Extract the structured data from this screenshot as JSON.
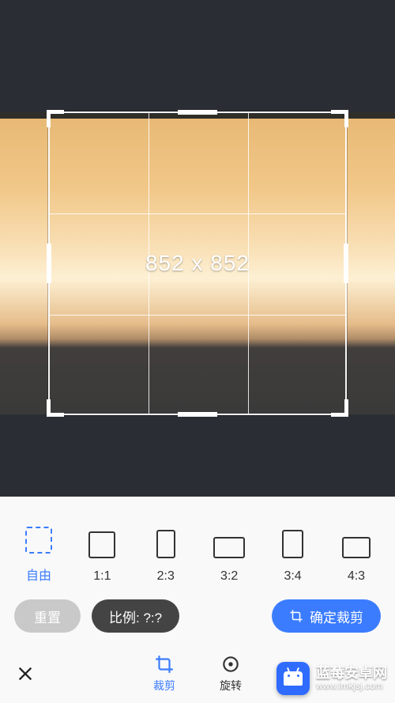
{
  "crop": {
    "dimensions_label": "852 x 852"
  },
  "ratios": [
    {
      "key": "free",
      "label": "自由",
      "active": true
    },
    {
      "key": "11",
      "label": "1:1",
      "active": false
    },
    {
      "key": "23",
      "label": "2:3",
      "active": false
    },
    {
      "key": "32",
      "label": "3:2",
      "active": false
    },
    {
      "key": "34",
      "label": "3:4",
      "active": false
    },
    {
      "key": "43",
      "label": "4:3",
      "active": false
    }
  ],
  "buttons": {
    "reset": "重置",
    "ratio_prompt": "比例: ?:?",
    "confirm": "确定裁剪"
  },
  "tabs": {
    "crop": "裁剪",
    "rotate": "旋转"
  },
  "watermark": {
    "title": "蓝莓安卓网",
    "url": "www.lmkjsj.com"
  }
}
